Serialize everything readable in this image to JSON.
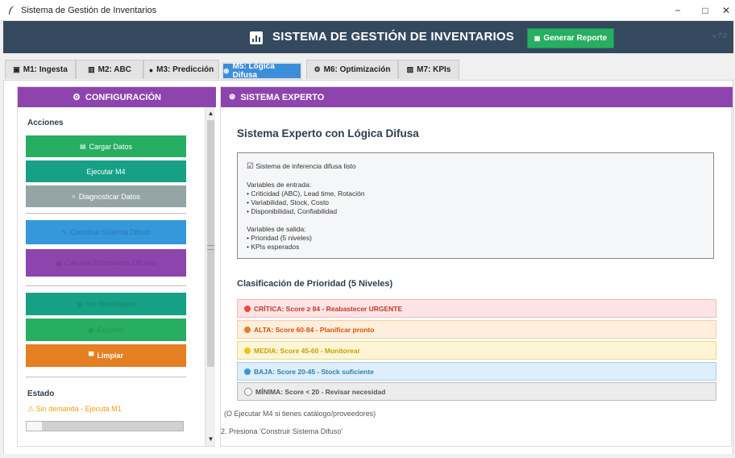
{
  "window": {
    "title": "Sistema de Gestión de Inventarios",
    "controls": {
      "minimize": "−",
      "maximize": "□",
      "close": "✕"
    }
  },
  "header": {
    "title": "SISTEMA DE GESTIÓN DE INVENTARIOS",
    "generate_button": "Generar Reporte",
    "version": "v 7.0",
    "colors": {
      "background": "#34495e",
      "button": "#27ae60"
    }
  },
  "tabs": [
    {
      "label": "M1: Ingesta",
      "icon": "📦"
    },
    {
      "label": "M2: ABC",
      "icon": "📊"
    },
    {
      "label": "M3: Predicción",
      "icon": "●"
    },
    {
      "label": "M5: Lógica Difusa",
      "icon": "🧠",
      "active": true
    },
    {
      "label": "M6: Optimización",
      "icon": "⚙"
    },
    {
      "label": "M7: KPIs",
      "icon": "📈"
    }
  ],
  "left_panel": {
    "title": "CONFIGURACIÓN",
    "actions_label": "Acciones",
    "buttons": [
      {
        "label": "Cargar Datos",
        "icon": "📁",
        "color": "#27ae60"
      },
      {
        "label": "Ejecutar M4",
        "icon": "",
        "color": "#16a085"
      },
      {
        "label": "Diagnosticar Datos",
        "icon": "🔍",
        "color": "#95a5a6"
      },
      {
        "label": "Construir Sistema Difuso",
        "icon": "🔧",
        "color": "#3498db"
      },
      {
        "label": "Calcular Prioridades Difusas",
        "icon": "🧮",
        "color": "#8e44ad"
      },
      {
        "label": "Ver Resultados",
        "icon": "📋",
        "color": "#16a085"
      },
      {
        "label": "Exportar",
        "icon": "💾",
        "color": "#27ae60"
      },
      {
        "label": "Limpiar",
        "icon": "🗑",
        "color": "#e67e22"
      }
    ],
    "status_label": "Estado",
    "status_text": "Sin demanda - Ejecuta M1",
    "progress": 0.1
  },
  "right_panel": {
    "title": "SISTEMA EXPERTO",
    "heading": "Sistema Experto con Lógica Difusa",
    "info_lines": [
      "Sistema de inferencia difusa listo",
      "Variables de entrada:",
      "• Criticidad (ABC), Lead time, Rotación",
      "• Variabilidad, Stock, Costo",
      "• Disponibilidad, Confiabilidad",
      "Variables de salida:",
      "• Prioridad (5 niveles)",
      "• KPIs esperados"
    ],
    "priority_heading": "Clasificación de Prioridad (5 Niveles)",
    "levels": [
      {
        "label": "CRÍTICA: Score ≥ 84 - Reabastecer URGENTE",
        "color": "#e74c3c",
        "bg": "#fde4e4",
        "border": "#f2b8b8",
        "text": "#c0392b"
      },
      {
        "label": "ALTA: Score 60-84 - Planificar pronto",
        "color": "#e67e22",
        "bg": "#fdeedd",
        "border": "#f3cfa6",
        "text": "#d35400"
      },
      {
        "label": "MEDIA: Score 45-60 - Monitorear",
        "color": "#f1c40f",
        "bg": "#fdf5d4",
        "border": "#ecd98b",
        "text": "#c9a000"
      },
      {
        "label": "BAJA: Score 20-45 - Stock suficiente",
        "color": "#3498db",
        "bg": "#deeefa",
        "border": "#a9cdeb",
        "text": "#2980b9"
      },
      {
        "label": "MÍNIMA: Score < 20 - Revisar necesidad",
        "color": "#7f8c8d",
        "bg": "#ececec",
        "border": "#bdbdbd",
        "text": "#555555"
      }
    ],
    "hint_lines": [
      "(O Ejecutar M4 si tienes catálogo/proveedores)",
      "2. Presiona 'Construir Sistema Difuso'"
    ]
  }
}
